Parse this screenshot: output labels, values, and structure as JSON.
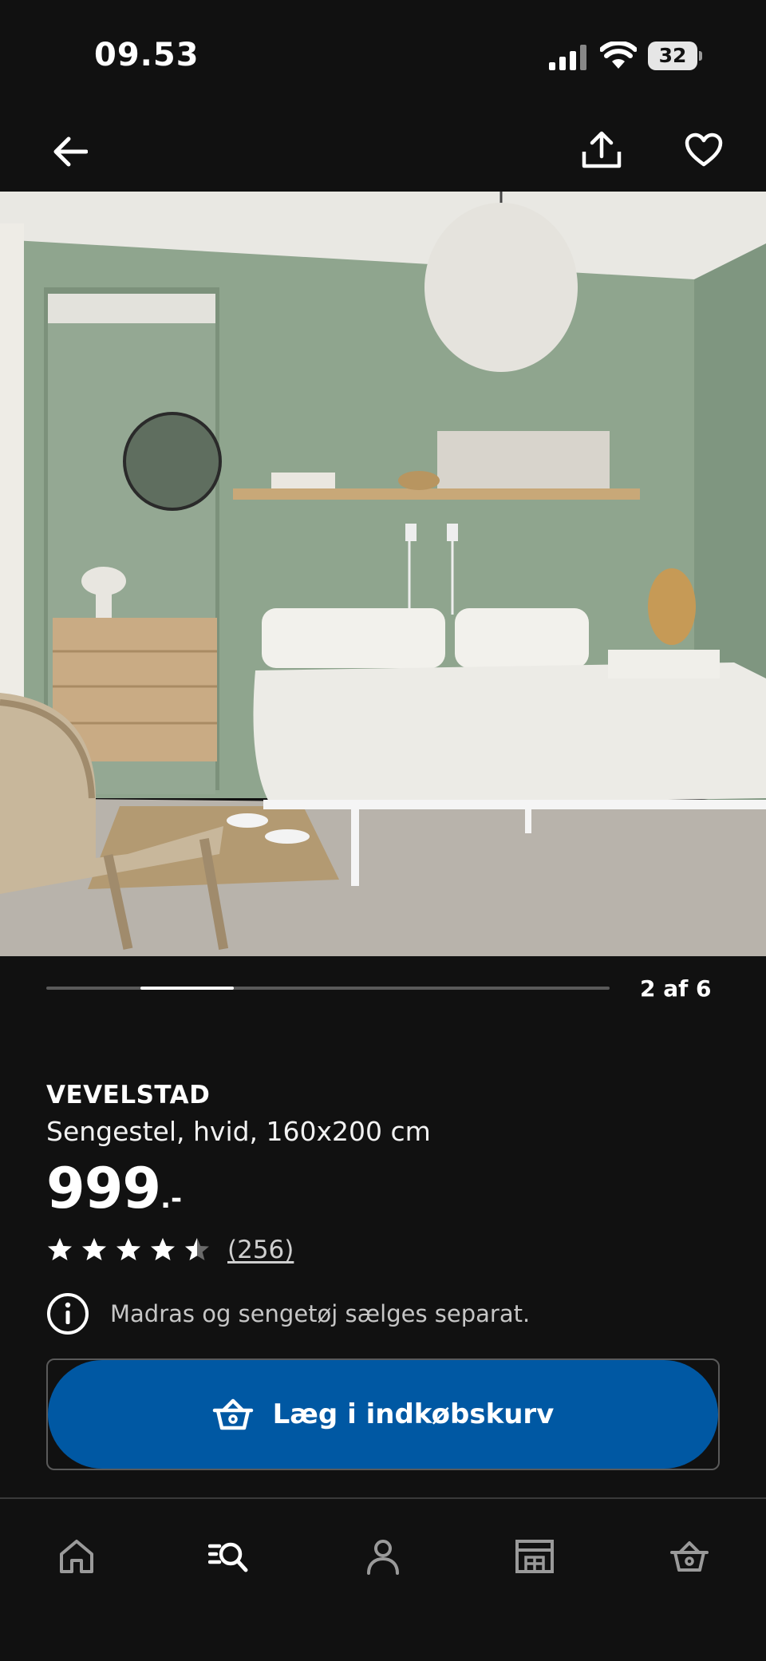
{
  "status_bar": {
    "time": "09.53",
    "battery": "32"
  },
  "top_nav": {
    "back_icon": "arrow-left-icon",
    "share_icon": "share-icon",
    "favorite_icon": "heart-icon"
  },
  "carousel": {
    "current": 2,
    "total": 6,
    "indicator": "2 af 6"
  },
  "product": {
    "name": "VEVELSTAD",
    "description": "Sengestel, hvid, 160x200 cm",
    "price": "999",
    "price_suffix": ".-",
    "rating": 4.5,
    "review_count": "(256)",
    "notice": "Madras og sengetøj sælges separat."
  },
  "cart": {
    "label": "Læg i indkøbskurv"
  },
  "tab_bar": {
    "items": [
      {
        "icon": "home-icon",
        "active": false
      },
      {
        "icon": "search-icon",
        "active": true
      },
      {
        "icon": "profile-icon",
        "active": false
      },
      {
        "icon": "store-icon",
        "active": false
      },
      {
        "icon": "basket-icon",
        "active": false
      }
    ]
  },
  "colors": {
    "background": "#111111",
    "accent_blue": "#0058a3",
    "text_primary": "#ffffff",
    "text_secondary": "#c6c6c6",
    "star": "#ffffff"
  }
}
